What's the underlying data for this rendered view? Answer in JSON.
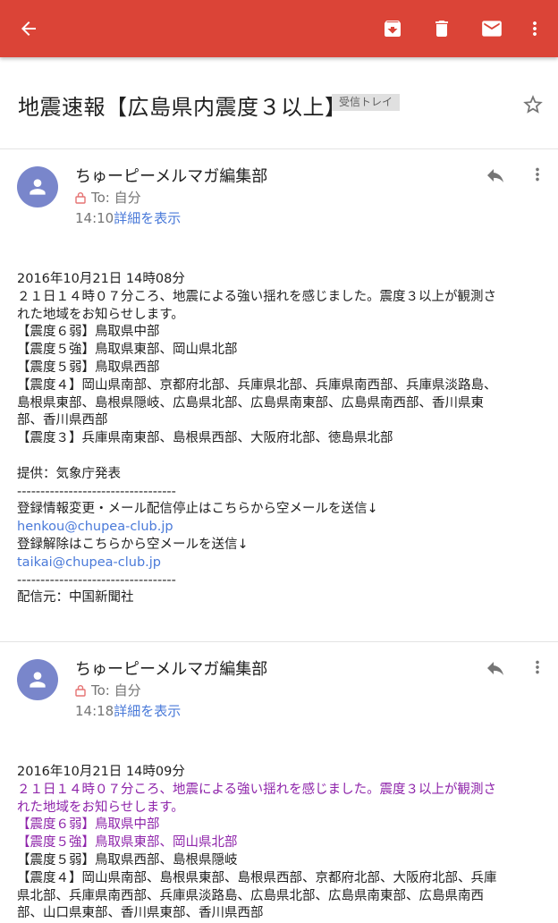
{
  "appbar": {
    "back_icon": "arrow-back-icon",
    "archive_icon": "archive-icon",
    "delete_icon": "trash-icon",
    "mark_unread_icon": "mail-icon",
    "more_icon": "more-vert-icon",
    "color": "#db4437"
  },
  "subject": {
    "title": "地震速報【広島県内震度３以上】",
    "label": "受信トレイ"
  },
  "messages": [
    {
      "sender": "ちゅーピーメルマガ編集部",
      "to": "To: 自分",
      "time": "14:10",
      "details": "詳細を表示",
      "body": {
        "date": "2016年10月21日 14時08分",
        "l1": "２１日１４時０７分ころ、地震による強い揺れを感じました。震度３以上が観測さ",
        "l2": "れた地域をお知らせします。",
        "l3": "【震度６弱】鳥取県中部",
        "l4": "【震度５強】鳥取県東部、岡山県北部",
        "l5": "【震度５弱】鳥取県西部",
        "l6": "【震度４】岡山県南部、京都府北部、兵庫県北部、兵庫県南西部、兵庫県淡路島、",
        "l7": "島根県東部、島根県隠岐、広島県北部、広島県南東部、広島県南西部、香川県東",
        "l8": "部、香川県西部",
        "l9": "【震度３】兵庫県南東部、島根県西部、大阪府北部、徳島県北部",
        "source": "提供：気象庁発表",
        "sep1": "----------------------------------",
        "change_notice": "登録情報変更・メール配信停止はこちらから空メールを送信↓",
        "change_email": "henkou@chupea-club.jp",
        "cancel_notice": "登録解除はこちらから空メールを送信↓",
        "cancel_email": "taikai@chupea-club.jp",
        "sep2": "----------------------------------",
        "distributor": "配信元：中国新聞社"
      }
    },
    {
      "sender": "ちゅーピーメルマガ編集部",
      "to": "To: 自分",
      "time": "14:18",
      "details": "詳細を表示",
      "body": {
        "date": "2016年10月21日 14時09分",
        "l1": "２１日１４時０７分ころ、地震による強い揺れを感じました。震度３以上が観測さ",
        "l2": "れた地域をお知らせします。",
        "l3": "【震度６弱】鳥取県中部",
        "l4": "【震度５強】鳥取県東部、岡山県北部",
        "l5": "【震度５弱】鳥取県西部、島根県隠岐",
        "l6": "【震度４】岡山県南部、島根県東部、島根県西部、京都府北部、大阪府北部、兵庫",
        "l7": "県北部、兵庫県南西部、兵庫県淡路島、広島県北部、広島県南東部、広島県南西",
        "l8": "部、山口県東部、香川県東部、香川県西部"
      }
    }
  ],
  "colors": {
    "avatar": "#7986cb",
    "link": "#4a7ad9",
    "quoted_purple": "#8e24aa"
  }
}
